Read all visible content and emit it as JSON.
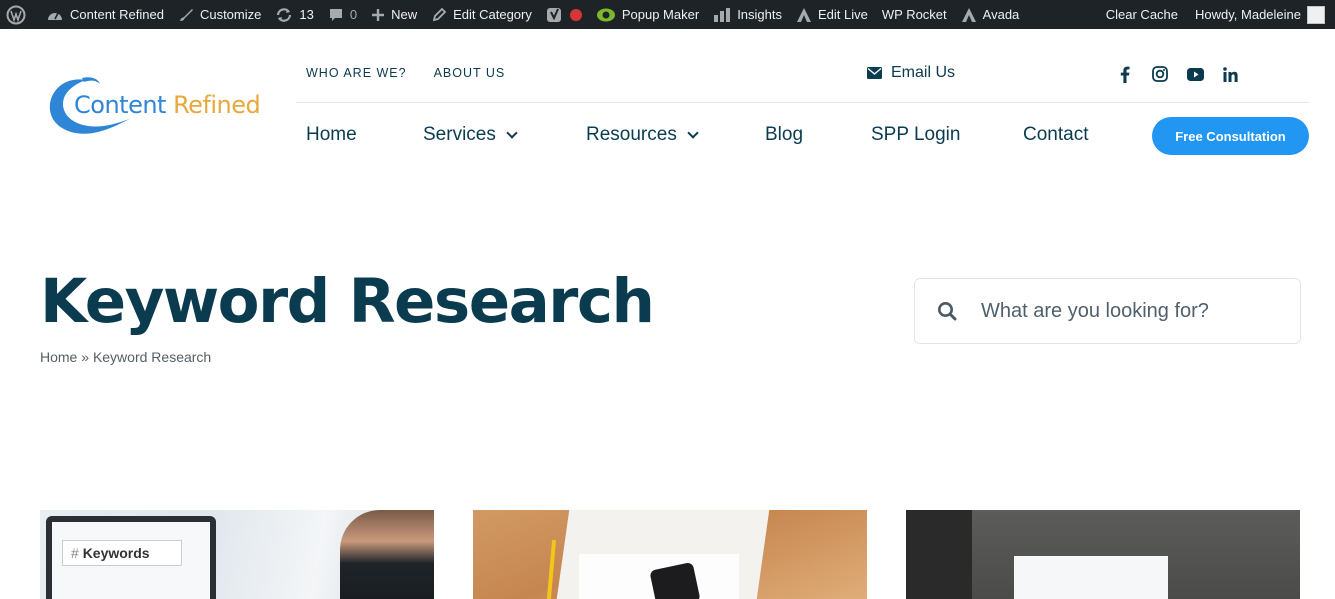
{
  "admin_bar": {
    "site_name": "Content Refined",
    "customize": "Customize",
    "updates_count": "13",
    "comments_count": "0",
    "new": "New",
    "edit_category": "Edit Category",
    "popup_maker": "Popup Maker",
    "insights": "Insights",
    "edit_live": "Edit Live",
    "wp_rocket": "WP Rocket",
    "avada": "Avada",
    "clear_cache": "Clear Cache",
    "howdy": "Howdy, Madeleine"
  },
  "header": {
    "logo_part1": "Content ",
    "logo_part2": "Refined",
    "top_nav": [
      "WHO ARE WE?",
      "ABOUT US"
    ],
    "email_label": "Email Us",
    "socials": [
      "facebook-icon",
      "instagram-icon",
      "youtube-icon",
      "linkedin-icon"
    ],
    "main_nav": [
      {
        "label": "Home"
      },
      {
        "label": "Services"
      },
      {
        "label": "Resources"
      },
      {
        "label": "Blog"
      },
      {
        "label": "SPP Login"
      },
      {
        "label": "Contact"
      }
    ],
    "cta_label": "Free Consultation"
  },
  "page": {
    "title": "Keyword Research",
    "breadcrumb_home": "Home",
    "breadcrumb_sep": "»",
    "breadcrumb_current": "Keyword Research"
  },
  "search": {
    "placeholder": "What are you looking for?"
  },
  "cards": {
    "card1_keyword": "Keywords"
  },
  "colors": {
    "admin_bar_bg": "#1d2327",
    "brand_navy": "#0a3b4f",
    "cta_blue": "#2196f3",
    "logo_blue": "#2f86d6",
    "logo_orange": "#e7a83c"
  }
}
